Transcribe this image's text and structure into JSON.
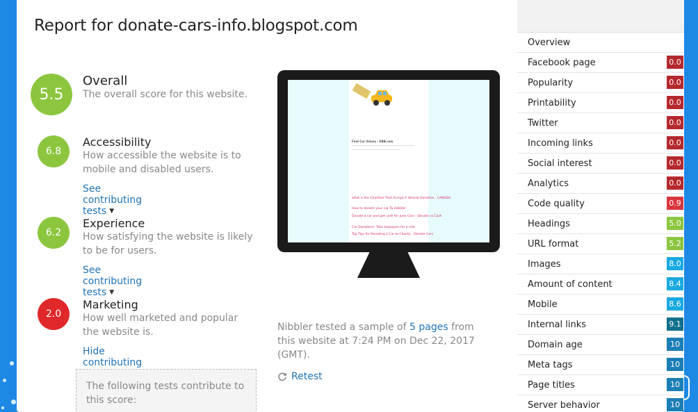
{
  "report_title": "Report for donate-cars-info.blogspot.com",
  "colors": {
    "green": "#8cc63f",
    "red": "#e0282a",
    "link": "#1f73b7"
  },
  "scores": {
    "overall": {
      "value": "5.5",
      "title": "Overall",
      "desc": "The overall score for this website."
    },
    "accessibility": {
      "value": "6.8",
      "title": "Accessibility",
      "desc": "How accessible the website is to mobile and disabled users.",
      "link": "See contributing tests"
    },
    "experience": {
      "value": "6.2",
      "title": "Experience",
      "desc": "How satisfying the website is likely to be for users.",
      "link": "See contributing tests"
    },
    "marketing": {
      "value": "2.0",
      "title": "Marketing",
      "desc": "How well marketed and popular the website is.",
      "link": "Hide contributing tests"
    }
  },
  "contrib_box": "The following tests contribute to this score:",
  "preview": {
    "heading": "Find Car Values - KBB.com",
    "links": [
      "what is the Charities That Accept A Vehicle Donation - CANADA",
      "How to donate your car To Habitat",
      "Donate a car and get cash for Junk Cars - Donate vs Cash",
      "Car Donations: Take taxpayers for a ride",
      "Top Tips for Donating a Car to Charity - Donate Cars"
    ]
  },
  "tested": {
    "prefix": "Nibbler tested a sample of ",
    "pages_link": "5 pages",
    "suffix": " from this website at 7:24 PM on Dec 22, 2017 (GMT)."
  },
  "retest_label": "Retest",
  "sidebar": {
    "items": [
      {
        "label": "Overview",
        "score": ""
      },
      {
        "label": "Facebook page",
        "score": "0.0",
        "color": "darkred"
      },
      {
        "label": "Popularity",
        "score": "0.0",
        "color": "darkred"
      },
      {
        "label": "Printability",
        "score": "0.0",
        "color": "darkred"
      },
      {
        "label": "Twitter",
        "score": "0.0",
        "color": "darkred"
      },
      {
        "label": "Incoming links",
        "score": "0.0",
        "color": "darkred"
      },
      {
        "label": "Social interest",
        "score": "0.0",
        "color": "darkred"
      },
      {
        "label": "Analytics",
        "score": "0.0",
        "color": "darkred"
      },
      {
        "label": "Code quality",
        "score": "0.9",
        "color": "red"
      },
      {
        "label": "Headings",
        "score": "5.0",
        "color": "green"
      },
      {
        "label": "URL format",
        "score": "5.2",
        "color": "green"
      },
      {
        "label": "Images",
        "score": "8.0",
        "color": "lightblue"
      },
      {
        "label": "Amount of content",
        "score": "8.4",
        "color": "lightblue"
      },
      {
        "label": "Mobile",
        "score": "8.6",
        "color": "lightblue"
      },
      {
        "label": "Internal links",
        "score": "9.1",
        "color": "teal"
      },
      {
        "label": "Domain age",
        "score": "10",
        "color": "blue"
      },
      {
        "label": "Meta tags",
        "score": "10",
        "color": "blue"
      },
      {
        "label": "Page titles",
        "score": "10",
        "color": "blue"
      },
      {
        "label": "Server behavior",
        "score": "10",
        "color": "blue"
      }
    ]
  }
}
